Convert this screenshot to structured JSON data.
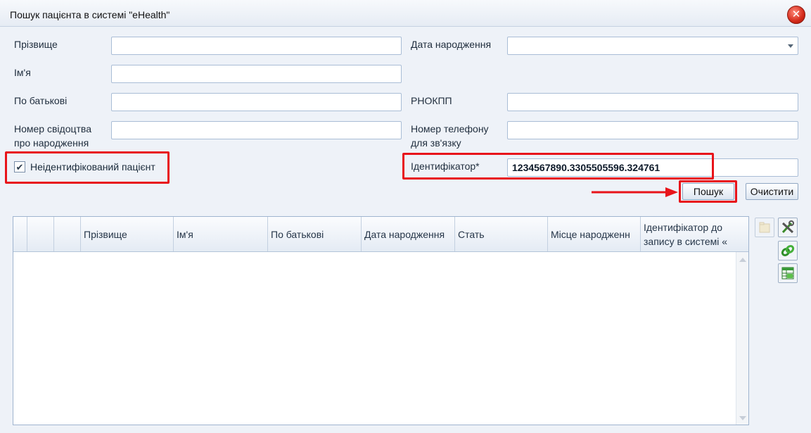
{
  "window": {
    "title": "Пошук пацієнта в системі \"eHealth\"",
    "close_symbol": "✕"
  },
  "form": {
    "surname_label": "Прізвище",
    "name_label": "Ім'я",
    "patronymic_label": "По батькові",
    "birth_cert_label_line1": "Номер свідоцтва",
    "birth_cert_label_line2": "про народження",
    "birth_date_label": "Дата народження",
    "rnokpp_label": "РНОКПП",
    "phone_label_line1": "Номер телефону",
    "phone_label_line2": "для зв'язку",
    "identifier_label": "Ідентифікатор*",
    "identifier_value": "1234567890.3305505596.324761",
    "unidentified_label": "Неідентифікований пацієнт",
    "unidentified_checked": true,
    "check_mark": "✔"
  },
  "buttons": {
    "search": "Пошук",
    "clear": "Очистити"
  },
  "grid": {
    "columns": [
      "Прізвище",
      "Ім'я",
      "По батькові",
      "Дата народження",
      "Стать",
      "Місце народженн",
      "Ідентифікатор до запису в системі «"
    ]
  },
  "toolbar": {
    "icons": [
      "folder-icon",
      "tools-icon",
      "link-icon",
      "table-icon"
    ]
  },
  "colors": {
    "highlight": "#e8141a",
    "border": "#a9bdd6",
    "background": "#eef2f8"
  }
}
